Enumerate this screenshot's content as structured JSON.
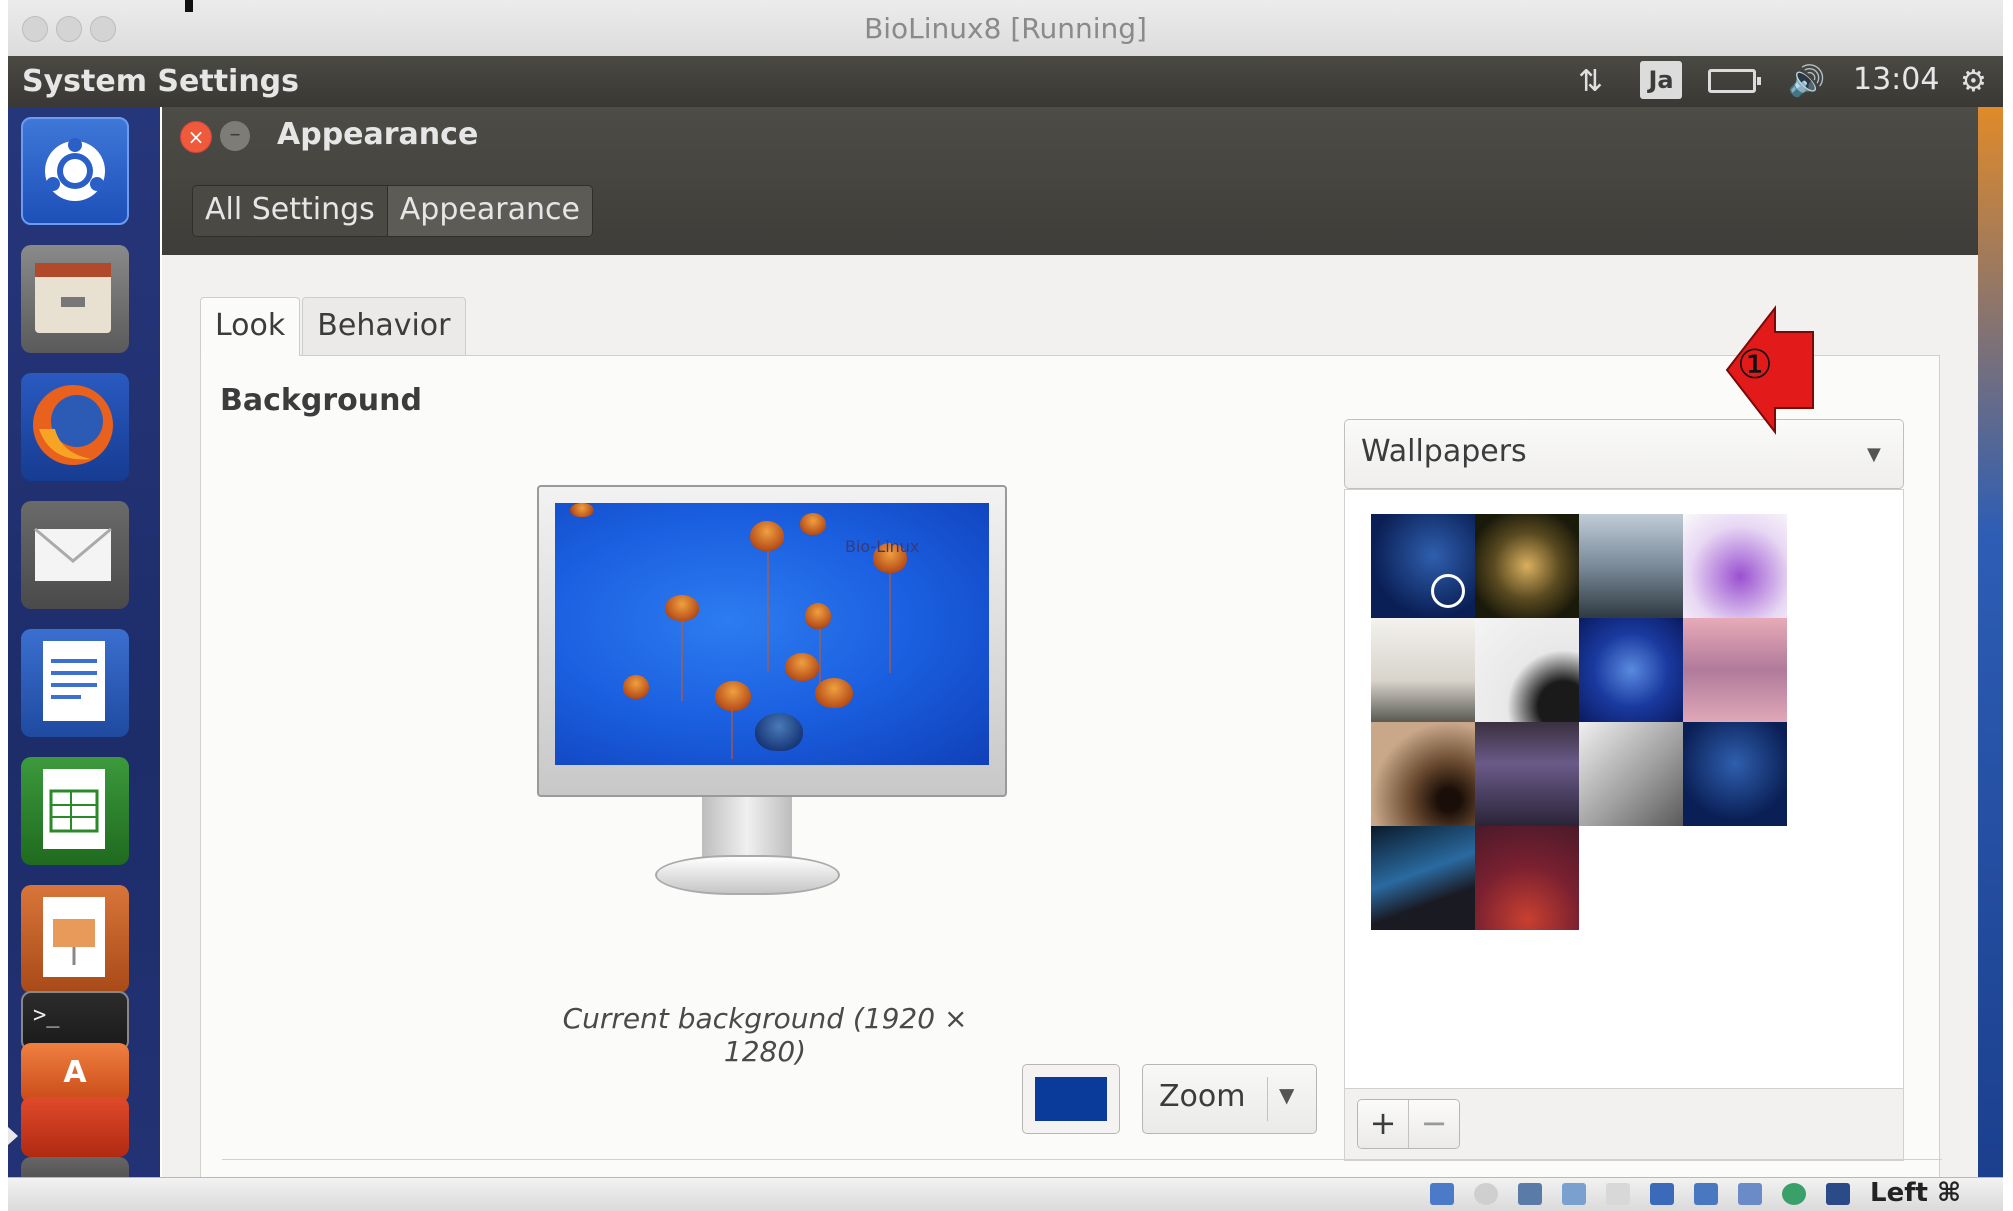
{
  "host_window": {
    "title": "BioLinux8 [Running]"
  },
  "panel": {
    "app_title": "System Settings",
    "keyboard_indicator": "Ja",
    "clock": "13:04"
  },
  "settings": {
    "window_title": "Appearance",
    "breadcrumbs": [
      "All Settings",
      "Appearance"
    ],
    "tabs": [
      "Look",
      "Behavior"
    ],
    "background_label": "Background",
    "monitor_watermark": "Bio-Linux",
    "current_background": "Current background (1920 × 1280)",
    "primary_color": "#0a3a9a",
    "zoom_value": "Zoom",
    "source_dropdown": "Wallpapers",
    "wallpapers": [
      "blue-network-timed",
      "mushrooms",
      "beach-rocks",
      "purple-flowers",
      "fog-landscape",
      "white-curve",
      "jellyfish-blue",
      "pink-reflection",
      "spiral-tunnel",
      "purple-road",
      "gray-sky-plane",
      "blue-network",
      "night-sky-galaxy",
      "ubuntu-warty-red"
    ],
    "add_label": "+",
    "remove_label": "−"
  },
  "annotation": {
    "number": "①",
    "color": "#e31a1a"
  },
  "status_bar": {
    "host_key": "Left ⌘"
  }
}
